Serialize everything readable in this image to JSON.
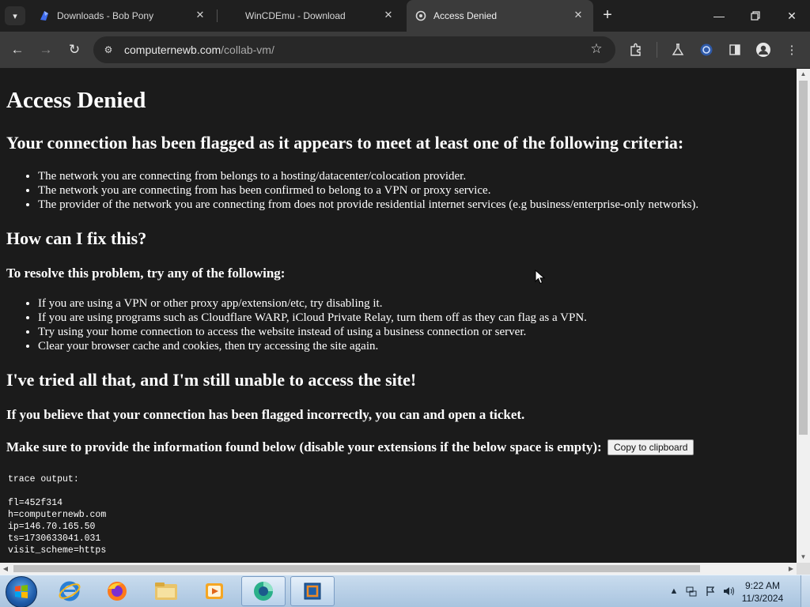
{
  "browser": {
    "tabs": [
      {
        "title": "Downloads - Bob Pony",
        "favicon": "bobpony-icon"
      },
      {
        "title": "WinCDEmu - Download",
        "favicon": "none"
      },
      {
        "title": "Access Denied",
        "favicon": "loading-icon",
        "active": true
      }
    ],
    "url_host": "computernewb.com",
    "url_path": "/collab-vm/"
  },
  "page": {
    "title": "Access Denied",
    "flagged_heading": "Your connection has been flagged as it appears to meet at least one of the following criteria:",
    "criteria": [
      "The network you are connecting from belongs to a hosting/datacenter/colocation provider.",
      "The network you are connecting from has been confirmed to belong to a VPN or proxy service.",
      "The provider of the network you are connecting from does not provide residential internet services (e.g business/enterprise-only networks)."
    ],
    "fix_heading": "How can I fix this?",
    "resolve_heading": "To resolve this problem, try any of the following:",
    "fixes": [
      "If you are using a VPN or other proxy app/extension/etc, try disabling it.",
      "If you are using programs such as Cloudflare WARP, iCloud Private Relay, turn them off as they can flag as a VPN.",
      "Try using your home connection to access the website instead of using a business connection or server.",
      "Clear your browser cache and cookies, then try accessing the site again."
    ],
    "still_heading": "I've tried all that, and I'm still unable to access the site!",
    "incorrect_prefix": "If you believe that your connection has been flagged incorrectly, you can",
    "incorrect_link": "",
    "incorrect_suffix": "and open a ticket.",
    "provide_text": "Make sure to provide the information found below (disable your extensions if the below space is empty):",
    "copy_button": "Copy to clipboard",
    "trace": "trace output:\n\nfl=452f314\nh=computernewb.com\nip=146.70.165.50\nts=1730633041.031\nvisit_scheme=https"
  },
  "taskbar": {
    "time": "9:22 AM",
    "date": "11/3/2024",
    "apps": [
      "internet-explorer-icon",
      "firefox-icon",
      "file-explorer-icon",
      "media-player-icon",
      "browser-icon",
      "virtualbox-icon"
    ]
  },
  "colors": {
    "page_bg": "#1b1b1b",
    "link": "#3b4cf2",
    "tab_active": "#3b3b3b",
    "tab_bar": "#1f1f1f"
  }
}
